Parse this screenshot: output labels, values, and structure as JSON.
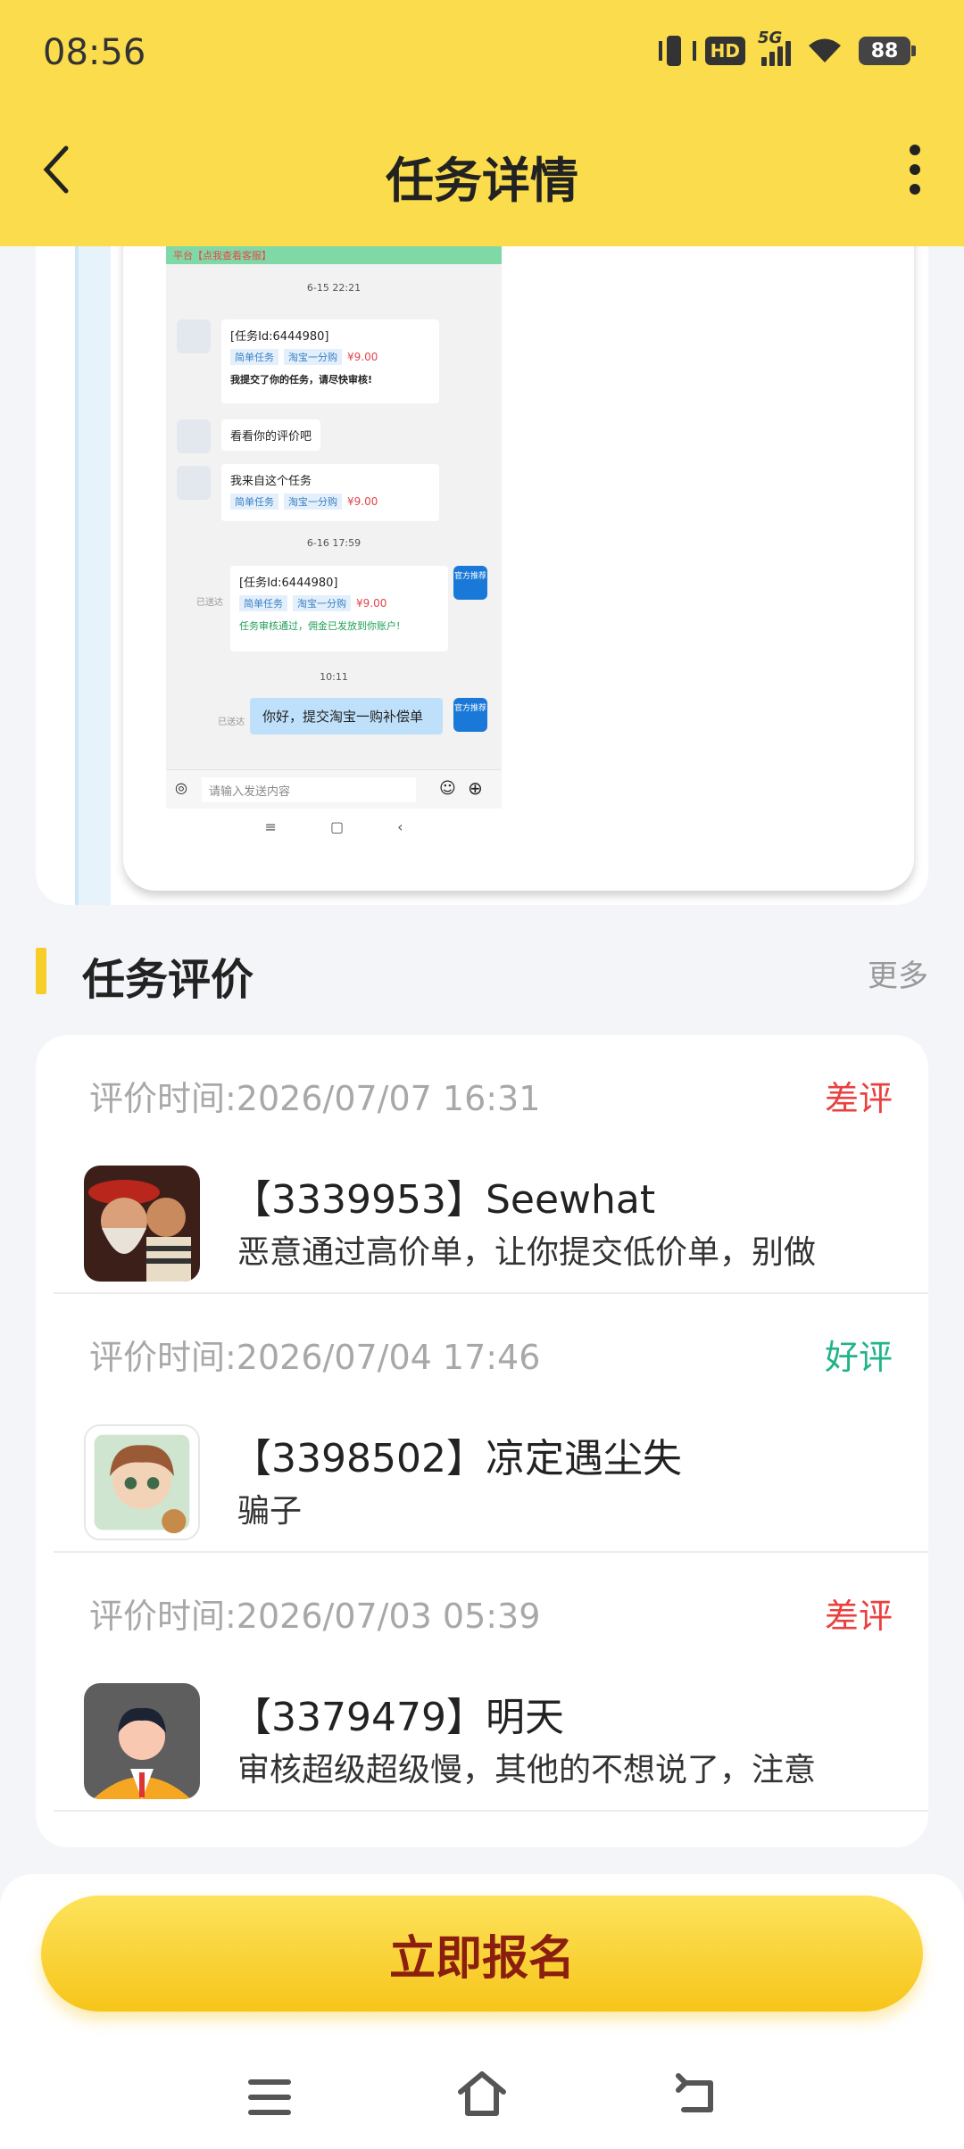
{
  "status": {
    "time": "08:56",
    "hd": "HD",
    "network": "5G",
    "battery": "88"
  },
  "header": {
    "title": "任务详情"
  },
  "chat": {
    "top_text": "平台【点我查看客服】",
    "ts1": "6-15 22:21",
    "card1": {
      "task_id": "[任务Id:6444980]",
      "tag1": "简单任务",
      "tag2": "淘宝一分购",
      "price": "¥9.00",
      "note": "我提交了你的任务，请尽快审核!"
    },
    "msg2": "看看你的评价吧",
    "card2": {
      "title": "我来自这个任务",
      "tag1": "简单任务",
      "tag2": "淘宝一分购",
      "price": "¥9.00"
    },
    "ts2": "6-16 17:59",
    "sent1": "已送达",
    "card3": {
      "task_id": "[任务Id:6444980]",
      "tag1": "简单任务",
      "tag2": "淘宝一分购",
      "price": "¥9.00",
      "note": "任务审核通过，佣金已发放到你账户!"
    },
    "official": "官方推荐",
    "ts3": "10:11",
    "sent2": "已送达",
    "blue_msg": "你好，提交淘宝一购补偿单",
    "input_placeholder": "请输入发送内容"
  },
  "section": {
    "title": "任务评价",
    "more": "更多"
  },
  "reviews": [
    {
      "time": "评价时间:2026/07/07 16:31",
      "rating": "差评",
      "rating_color": "#e8413f",
      "name": "【3339953】Seewhat",
      "text": "恶意通过高价单，让你提交低价单，别做"
    },
    {
      "time": "评价时间:2026/07/04 17:46",
      "rating": "好评",
      "rating_color": "#22b38a",
      "name": "【3398502】凉定遇尘失",
      "text": "骗子"
    },
    {
      "time": "评价时间:2026/07/03 05:39",
      "rating": "差评",
      "rating_color": "#e8413f",
      "name": "【3379479】明天",
      "text": "审核超级超级慢，其他的不想说了，注意"
    }
  ],
  "action": {
    "signup": "立即报名"
  }
}
